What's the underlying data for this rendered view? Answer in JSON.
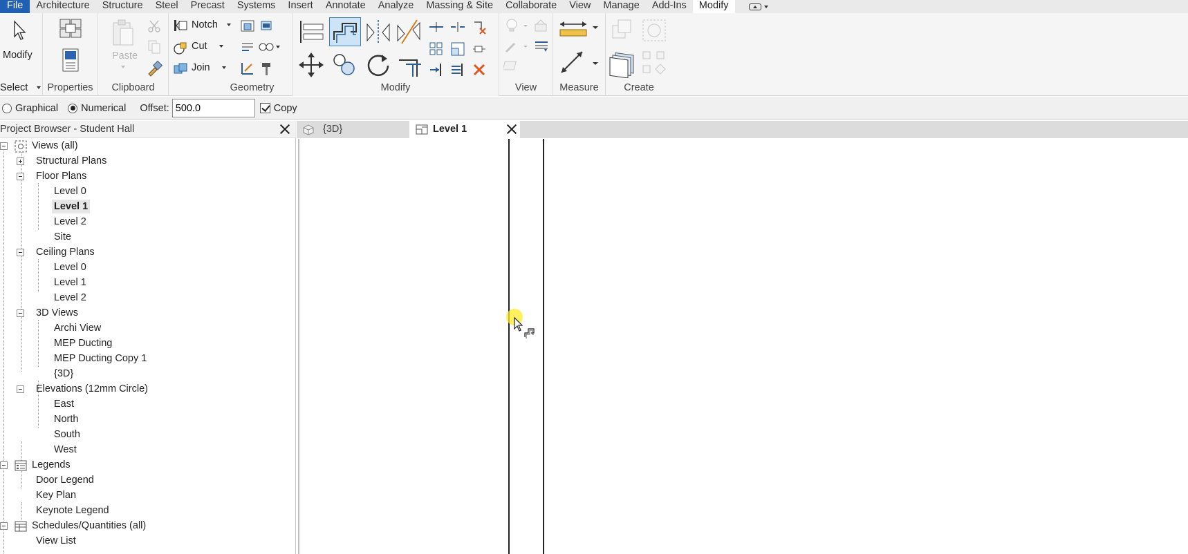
{
  "menubar": {
    "items": [
      "File",
      "Architecture",
      "Structure",
      "Steel",
      "Precast",
      "Systems",
      "Insert",
      "Annotate",
      "Analyze",
      "Massing & Site",
      "Collaborate",
      "View",
      "Manage",
      "Add-Ins",
      "Modify"
    ],
    "active": "Modify"
  },
  "ribbon": {
    "modify_label": "Modify",
    "select_label": "Select",
    "paste_label": "Paste",
    "notch_label": "Notch",
    "cut_label": "Cut",
    "join_label": "Join",
    "panels": {
      "properties": "Properties",
      "clipboard": "Clipboard",
      "geometry": "Geometry",
      "modify": "Modify",
      "view": "View",
      "measure": "Measure",
      "create": "Create"
    }
  },
  "options": {
    "graphical_label": "Graphical",
    "numerical_label": "Numerical",
    "offset_label": "Offset:",
    "offset_value": "500.0",
    "copy_label": "Copy",
    "numerical_selected": true,
    "copy_checked": true
  },
  "browser": {
    "title": "Project Browser - Student Hall",
    "views_all": "Views (all)",
    "structural_plans": "Structural Plans",
    "floor_plans": "Floor Plans",
    "floor_items": [
      "Level 0",
      "Level 1",
      "Level 2",
      "Site"
    ],
    "ceiling_plans": "Ceiling Plans",
    "ceiling_items": [
      "Level 0",
      "Level 1",
      "Level 2"
    ],
    "views_3d": "3D Views",
    "views_3d_items": [
      "Archi View",
      "MEP Ducting",
      "MEP Ducting Copy 1",
      "{3D}"
    ],
    "elevations": "Elevations (12mm Circle)",
    "elevation_items": [
      "East",
      "North",
      "South",
      "West"
    ],
    "legends": "Legends",
    "legend_items": [
      "Door Legend",
      "Key Plan",
      "Keynote Legend"
    ],
    "schedules": "Schedules/Quantities (all)",
    "schedule_items": [
      "View List"
    ]
  },
  "tabs": [
    {
      "label": "{3D}",
      "active": false
    },
    {
      "label": "Level 1",
      "active": true
    }
  ],
  "colors": {
    "file_tab": "#1f5fb4",
    "ribbon_bg": "#f5f5f5",
    "active_tool_bg": "#cde4f7",
    "active_tool_border": "#3c7fc1",
    "cursor_highlight": "#ffec28"
  }
}
